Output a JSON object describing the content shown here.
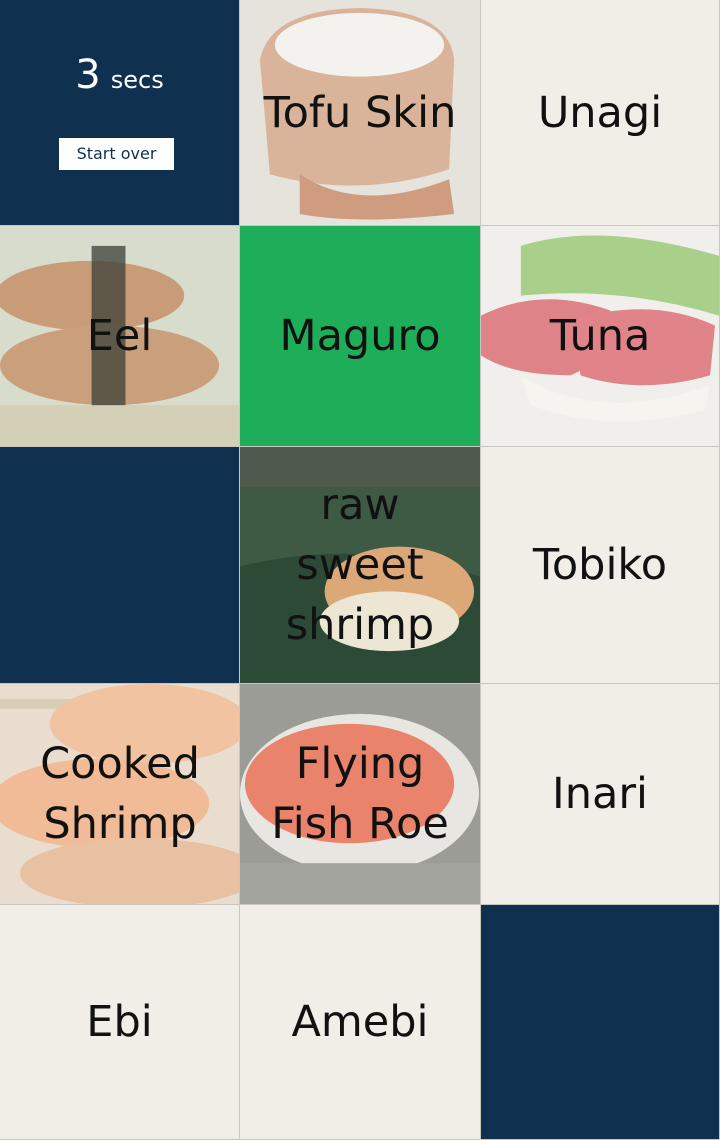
{
  "timer": {
    "value": "3",
    "unit": "secs"
  },
  "controls": {
    "start_over_label": "Start over"
  },
  "tiles": [
    {
      "label": "",
      "style": "navy"
    },
    {
      "label": "Tofu Skin",
      "style": "photo",
      "image": "inari-sushi"
    },
    {
      "label": "Unagi",
      "style": "plain"
    },
    {
      "label": "Eel",
      "style": "photo",
      "image": "eel-sushi"
    },
    {
      "label": "Maguro",
      "style": "green"
    },
    {
      "label": "Tuna",
      "style": "photo",
      "image": "tuna-sushi"
    },
    {
      "label": "",
      "style": "navy"
    },
    {
      "label": "raw sweet shrimp",
      "style": "photo",
      "image": "sweet-shrimp-sushi"
    },
    {
      "label": "Tobiko",
      "style": "plain"
    },
    {
      "label": "Cooked Shrimp",
      "style": "photo",
      "image": "cooked-shrimp-sushi"
    },
    {
      "label": "Flying Fish Roe",
      "style": "photo",
      "image": "fish-roe-sushi"
    },
    {
      "label": "Inari",
      "style": "plain"
    },
    {
      "label": "Ebi",
      "style": "plain"
    },
    {
      "label": "Amebi",
      "style": "plain"
    },
    {
      "label": "",
      "style": "navy"
    }
  ],
  "colors": {
    "navy": "#10304f",
    "matched_green": "#1eae5a",
    "tile_background": "#f1eee8"
  }
}
